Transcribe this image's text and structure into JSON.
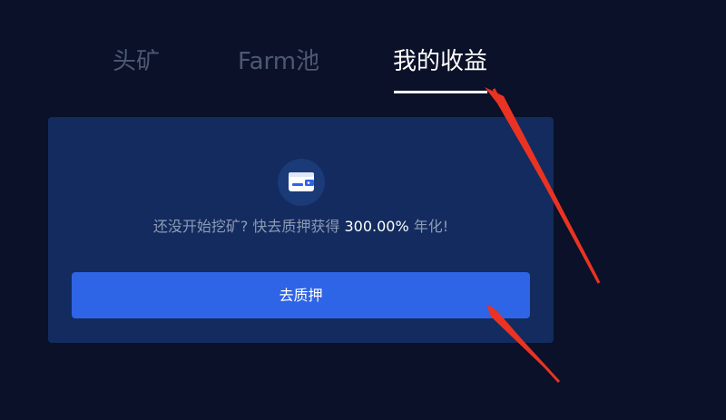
{
  "tabs": [
    {
      "label": "头矿",
      "active": false
    },
    {
      "label": "Farm池",
      "active": false
    },
    {
      "label": "我的收益",
      "active": true
    }
  ],
  "empty_state": {
    "icon": "wallet-icon",
    "text_before": "还没开始挖矿? 快去质押获得 ",
    "apy": "300.00%",
    "text_after": " 年化!"
  },
  "stake_button_label": "去质押",
  "colors": {
    "background": "#0a1128",
    "card": "#132b5e",
    "button": "#2e64e6",
    "annotation_arrow": "#ea3323"
  }
}
